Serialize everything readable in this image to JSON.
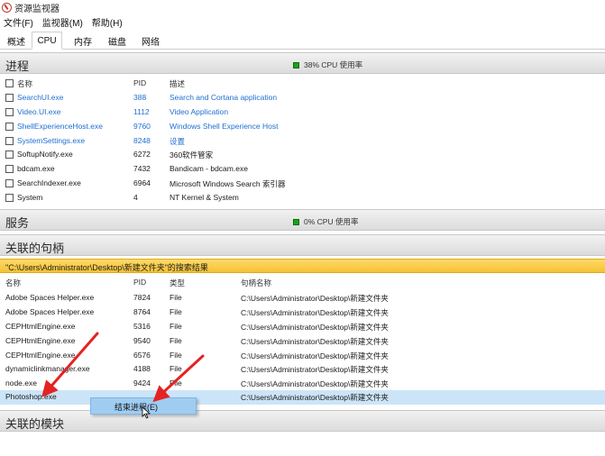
{
  "window": {
    "title": "资源监视器"
  },
  "menu": [
    "文件(F)",
    "监视器(M)",
    "帮助(H)"
  ],
  "tabs": [
    "概述",
    "CPU",
    "内存",
    "磁盘",
    "网络"
  ],
  "active_tab": "CPU",
  "processes": {
    "title": "进程",
    "cpu_status": "38% CPU 使用率",
    "headers": {
      "name": "名称",
      "pid": "PID",
      "desc": "描述"
    },
    "rows": [
      {
        "name": "SearchUI.exe",
        "pid": "388",
        "desc": "Search and Cortana application",
        "blue": true
      },
      {
        "name": "Video.UI.exe",
        "pid": "1112",
        "desc": "Video Application",
        "blue": true
      },
      {
        "name": "ShellExperienceHost.exe",
        "pid": "9760",
        "desc": "Windows Shell Experience Host",
        "blue": true
      },
      {
        "name": "SystemSettings.exe",
        "pid": "8248",
        "desc": "设置",
        "blue": true
      },
      {
        "name": "SoftupNotify.exe",
        "pid": "6272",
        "desc": "360软件管家",
        "blue": false
      },
      {
        "name": "bdcam.exe",
        "pid": "7432",
        "desc": "Bandicam - bdcam.exe",
        "blue": false
      },
      {
        "name": "SearchIndexer.exe",
        "pid": "6964",
        "desc": "Microsoft Windows Search 索引器",
        "blue": false
      },
      {
        "name": "System",
        "pid": "4",
        "desc": "NT Kernel & System",
        "blue": false
      }
    ]
  },
  "services": {
    "title": "服务",
    "cpu_status": "0% CPU 使用率"
  },
  "handles": {
    "title": "关联的句柄",
    "search_result": "\"C:\\Users\\Administrator\\Desktop\\新建文件夹\"的搜索结果",
    "headers": {
      "name": "名称",
      "pid": "PID",
      "type": "类型",
      "handle": "句柄名称"
    },
    "rows": [
      {
        "name": "Adobe Spaces Helper.exe",
        "pid": "7824",
        "type": "File",
        "handle": "C:\\Users\\Administrator\\Desktop\\新建文件夹"
      },
      {
        "name": "Adobe Spaces Helper.exe",
        "pid": "8764",
        "type": "File",
        "handle": "C:\\Users\\Administrator\\Desktop\\新建文件夹"
      },
      {
        "name": "CEPHtmlEngine.exe",
        "pid": "5316",
        "type": "File",
        "handle": "C:\\Users\\Administrator\\Desktop\\新建文件夹"
      },
      {
        "name": "CEPHtmlEngine.exe",
        "pid": "9540",
        "type": "File",
        "handle": "C:\\Users\\Administrator\\Desktop\\新建文件夹"
      },
      {
        "name": "CEPHtmlEngine.exe",
        "pid": "6576",
        "type": "File",
        "handle": "C:\\Users\\Administrator\\Desktop\\新建文件夹"
      },
      {
        "name": "dynamiclinkmanager.exe",
        "pid": "4188",
        "type": "File",
        "handle": "C:\\Users\\Administrator\\Desktop\\新建文件夹"
      },
      {
        "name": "node.exe",
        "pid": "9424",
        "type": "File",
        "handle": "C:\\Users\\Administrator\\Desktop\\新建文件夹"
      },
      {
        "name": "Photoshop.exe",
        "pid": "",
        "type": "",
        "handle": "C:\\Users\\Administrator\\Desktop\\新建文件夹"
      }
    ]
  },
  "context_menu": {
    "item": "结束进程(E)"
  },
  "modules": {
    "title": "关联的模块"
  },
  "colors": {
    "accent_green": "#17a41a",
    "link_blue": "#1f6fd1",
    "search_bar": "#f4c233",
    "selection": "#cce4f7",
    "annotation_red": "#e52222"
  }
}
